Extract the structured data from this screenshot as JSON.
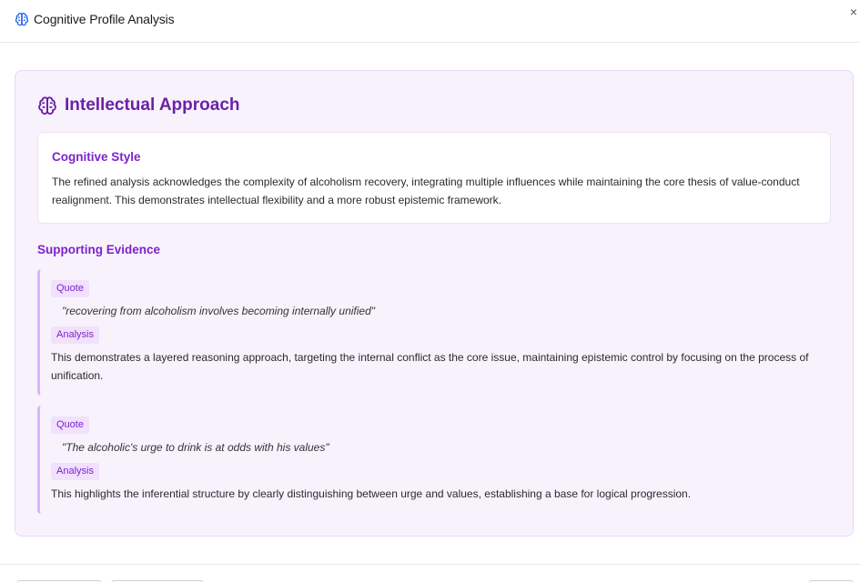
{
  "header": {
    "title": "Cognitive Profile Analysis",
    "icon": "brain-icon",
    "close_label": "×"
  },
  "section": {
    "title": "Intellectual Approach",
    "icon": "brain-icon",
    "accent_color": "#6b21a8"
  },
  "cognitive_style": {
    "title": "Cognitive Style",
    "text": "The refined analysis acknowledges the complexity of alcoholism recovery, integrating multiple influences while maintaining the core thesis of value-conduct realignment. This demonstrates intellectual flexibility and a more robust epistemic framework."
  },
  "evidence": {
    "title": "Supporting Evidence",
    "items": [
      {
        "quote_label": "Quote",
        "quote": "\"recovering from alcoholism involves becoming internally unified\"",
        "analysis_label": "Analysis",
        "analysis": "This demonstrates a layered reasoning approach, targeting the internal conflict as the core issue, maintaining epistemic control by focusing on the process of unification."
      },
      {
        "quote_label": "Quote",
        "quote": "\"The alcoholic's urge to drink is at odds with his values\"",
        "analysis_label": "Analysis",
        "analysis": "This highlights the inferential structure by clearly distinguishing between urge and values, establishing a base for logical progression."
      }
    ]
  },
  "colors": {
    "card_bg": "#f8f2fd",
    "accent": "#7e22ce",
    "evidence_border": "#d8b4fe",
    "header_icon": "#2563eb"
  }
}
